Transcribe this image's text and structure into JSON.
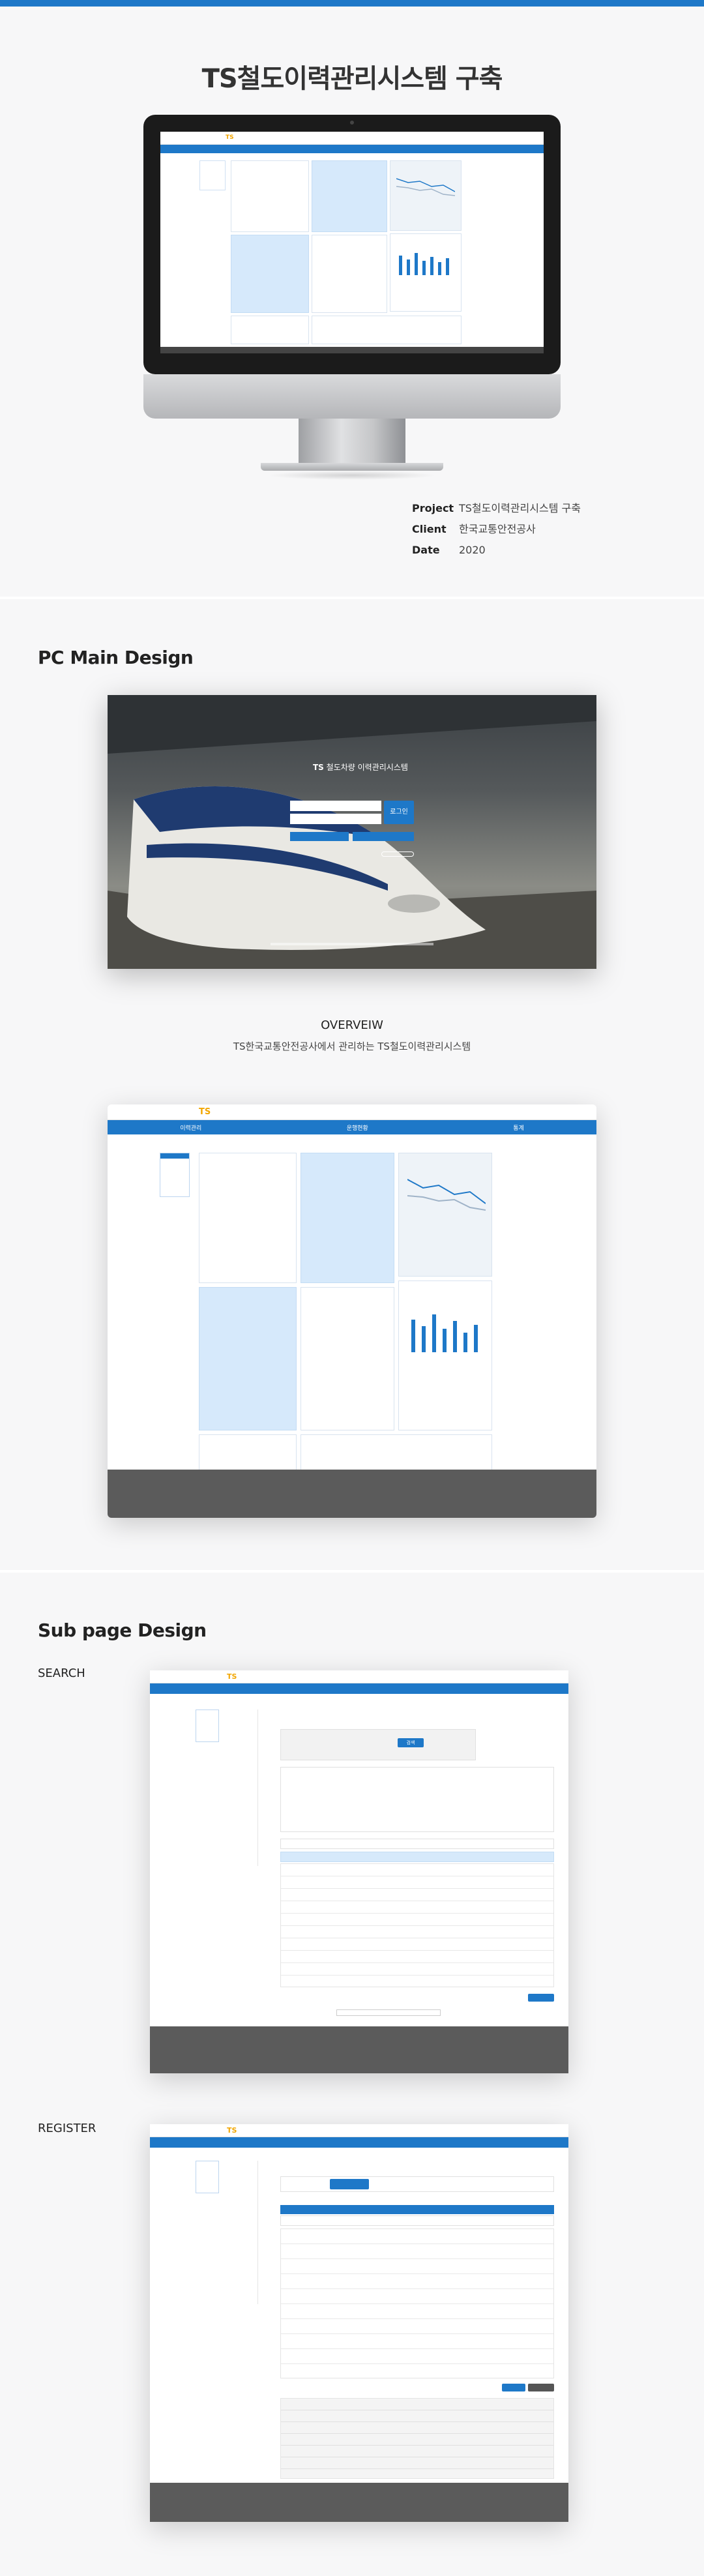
{
  "project_title": "TS철도이력관리시스템 구축",
  "project_info": {
    "project_label": "Project",
    "project_value": "TS철도이력관리시스템 구축",
    "client_label": "Client",
    "client_value": "한국교통안전공사",
    "date_label": "Date",
    "date_value": "2020"
  },
  "sections": {
    "pc_main": "PC Main Design",
    "overview_title": "OVERVEIW",
    "overview_text": "TS한국교통안전공사에서 관리하는 TS철도이력관리시스템",
    "sub_page": "Sub page Design",
    "search": "SEARCH",
    "register": "REGISTER"
  },
  "app": {
    "brand_mark": "TS",
    "brand_name": "철도차량 이력관리시스템",
    "login_button": "로그인",
    "nav": [
      "이력관리",
      "운행현황",
      "통계"
    ],
    "search_button": "검색"
  },
  "colors": {
    "brand_blue": "#1e78c8",
    "panel_blue": "#d6e9fb",
    "accent_yellow": "#f2a600",
    "footer_gray": "#5b5b5b",
    "page_bg": "#f7f7f8"
  }
}
